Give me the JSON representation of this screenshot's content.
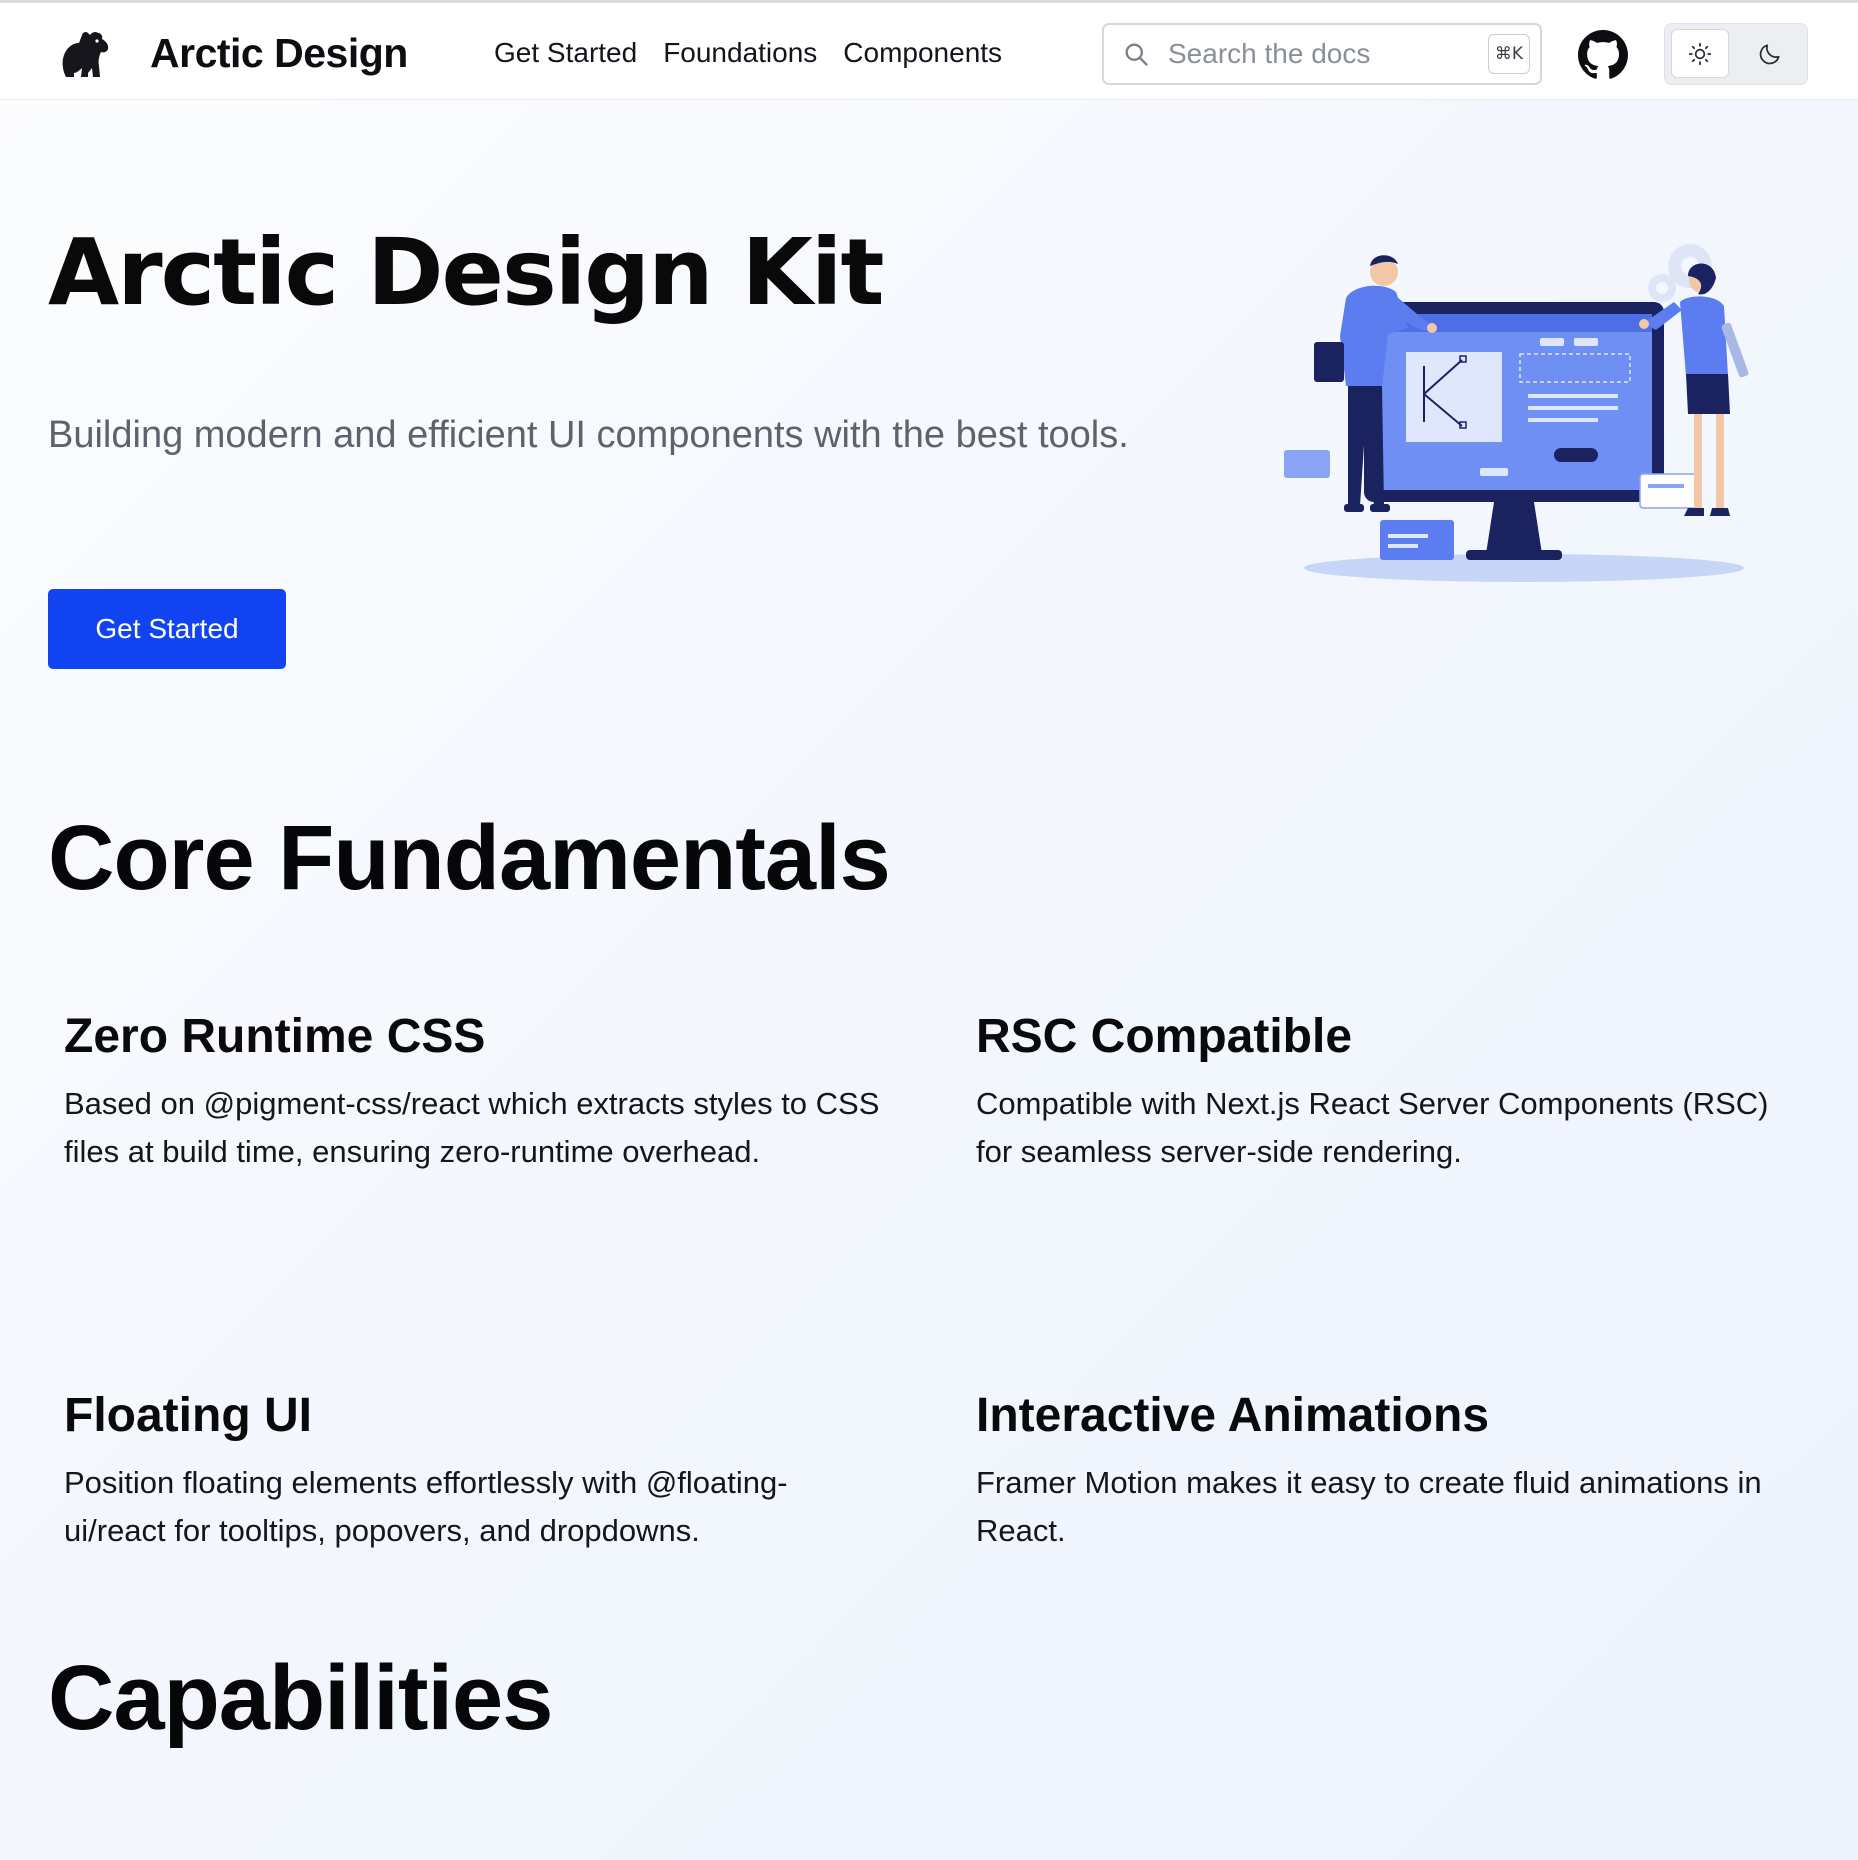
{
  "header": {
    "brand_name": "Arctic Design",
    "nav": [
      {
        "label": "Get Started"
      },
      {
        "label": "Foundations"
      },
      {
        "label": "Components"
      }
    ],
    "search": {
      "placeholder": "Search the docs",
      "shortcut": "⌘K"
    },
    "icons": {
      "logo": "bear-icon",
      "search": "search-icon",
      "github": "github-icon",
      "light_mode": "sun-icon",
      "dark_mode": "moon-icon"
    },
    "theme": {
      "selected": "light"
    }
  },
  "hero": {
    "title": "Arctic Design Kit",
    "subtitle": "Building modern and efficient UI components with the best tools.",
    "cta_label": "Get Started"
  },
  "core": {
    "title": "Core Fundamentals",
    "features": [
      {
        "title": "Zero Runtime CSS",
        "description": "Based on @pigment-css/react which extracts styles to CSS files at build time, ensuring zero-runtime overhead."
      },
      {
        "title": "RSC Compatible",
        "description": "Compatible with Next.js React Server Components (RSC) for seamless server-side rendering."
      },
      {
        "title": "Floating UI",
        "description": "Position floating elements effortlessly with @floating-ui/react for tooltips, popovers, and dropdowns."
      },
      {
        "title": "Interactive Animations",
        "description": "Framer Motion makes it easy to create fluid animations in React."
      }
    ]
  },
  "capabilities": {
    "title": "Capabilities"
  },
  "colors": {
    "accent": "#1144f0",
    "illustration_primary": "#5b7df0",
    "illustration_dark": "#1a2360"
  }
}
